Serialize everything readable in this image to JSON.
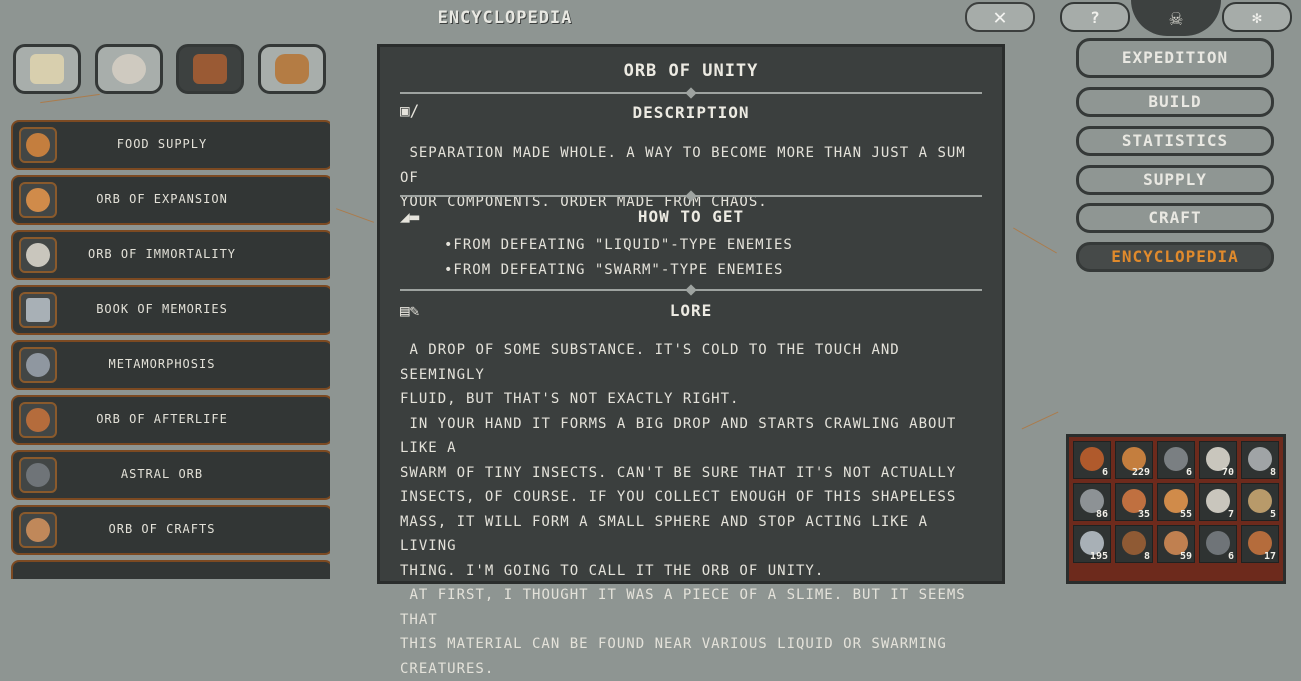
{
  "header": {
    "title": "Encyclopedia",
    "close_glyph": "✕"
  },
  "categories": [
    {
      "name": "map-icon",
      "color": "#d8cfae",
      "active": false
    },
    {
      "name": "skull-icon",
      "color": "#cfcac0",
      "active": false
    },
    {
      "name": "resource-icon",
      "color": "#9a5a34",
      "active": true
    },
    {
      "name": "barrel-icon",
      "color": "#b47c44",
      "active": false
    }
  ],
  "list": {
    "items": [
      {
        "label": "Food Supply",
        "icon": "food-supply-icon",
        "color": "#c47e3e"
      },
      {
        "label": "Orb of Expansion",
        "icon": "orb-of-expansion-icon",
        "color": "#d08b4a"
      },
      {
        "label": "Orb of Immortality",
        "icon": "orb-of-immortality-icon",
        "color": "#c9c6bd"
      },
      {
        "label": "Book of Memories",
        "icon": "book-of-memories-icon",
        "color": "#a8b0b6"
      },
      {
        "label": "Metamorphosis",
        "icon": "metamorphosis-icon",
        "color": "#8f97a0"
      },
      {
        "label": "Orb of Afterlife",
        "icon": "orb-of-afterlife-icon",
        "color": "#b56c3c"
      },
      {
        "label": "Astral Orb",
        "icon": "astral-orb-icon",
        "color": "#6f7478"
      },
      {
        "label": "Orb of Crafts",
        "icon": "orb-of-crafts-icon",
        "color": "#c0885a"
      }
    ]
  },
  "detail": {
    "title": "Orb of Unity",
    "description": {
      "heading": "Description",
      "text": " Separation made whole. A way to become more than just a sum of\nyour components. Order made from chaos."
    },
    "how_to_get": {
      "heading": "How to get",
      "items": [
        "•From defeating \"Liquid\"-type enemies",
        "•From defeating \"Swarm\"-type enemies"
      ]
    },
    "lore": {
      "heading": "Lore",
      "text": " A drop of some substance. It's cold to the touch and seemingly\nfluid, but that's not exactly right.\n In your hand it forms a big drop and starts crawling about like a\nswarm of tiny insects. Can't be sure that it's not actually\ninsects, of course. If you collect enough of this shapeless\nmass, it will form a small sphere and stop acting like a living\nthing. I'm going to call it the Orb of Unity.\n At first, I thought it was a piece of a slime. But it seems that\nthis material can be found near various liquid or swarming\ncreatures."
    }
  },
  "menu": {
    "top_left_glyph": "?",
    "top_right_glyph": "✻",
    "skull_glyph": "☠",
    "items": [
      {
        "label": "Expedition",
        "active": false
      },
      {
        "label": "Build",
        "active": false
      },
      {
        "label": "Statistics",
        "active": false
      },
      {
        "label": "Supply",
        "active": false
      },
      {
        "label": "Craft",
        "active": false
      },
      {
        "label": "Encyclopedia",
        "active": true
      }
    ]
  },
  "inventory": {
    "slots": [
      {
        "count": "6",
        "color": "#b05a2c"
      },
      {
        "count": "229",
        "color": "#c47e3e"
      },
      {
        "count": "6",
        "color": "#7a7f82"
      },
      {
        "count": "70",
        "color": "#c9c6bd"
      },
      {
        "count": "8",
        "color": "#a0a4a6"
      },
      {
        "count": "86",
        "color": "#8d9295"
      },
      {
        "count": "35",
        "color": "#c07040"
      },
      {
        "count": "55",
        "color": "#d08b4a"
      },
      {
        "count": "7",
        "color": "#c9c6bd"
      },
      {
        "count": "5",
        "color": "#b89a6a"
      },
      {
        "count": "195",
        "color": "#a8b0b6"
      },
      {
        "count": "8",
        "color": "#8f5a34"
      },
      {
        "count": "59",
        "color": "#c08050"
      },
      {
        "count": "6",
        "color": "#6f7478"
      },
      {
        "count": "17",
        "color": "#b56c3c"
      }
    ]
  }
}
